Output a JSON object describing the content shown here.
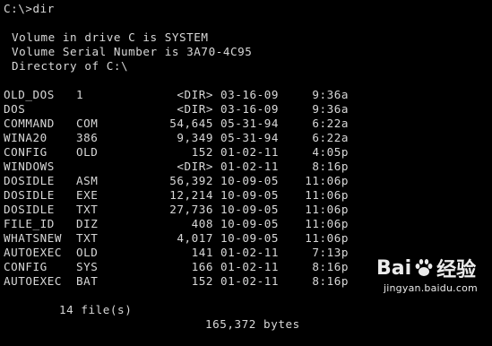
{
  "console": {
    "prompt": "C:\\>dir",
    "volume_label_line": "Volume in drive C is SYSTEM",
    "serial_line": "Volume Serial Number is 3A70-4C95",
    "directory_line": "Directory of C:\\",
    "entries": [
      {
        "name": "OLD_DOS",
        "ext": "1",
        "size": "<DIR>",
        "date": "03-16-09",
        "time": "9:36a"
      },
      {
        "name": "DOS",
        "ext": "",
        "size": "<DIR>",
        "date": "03-16-09",
        "time": "9:36a"
      },
      {
        "name": "COMMAND",
        "ext": "COM",
        "size": "54,645",
        "date": "05-31-94",
        "time": "6:22a"
      },
      {
        "name": "WINA20",
        "ext": "386",
        "size": "9,349",
        "date": "05-31-94",
        "time": "6:22a"
      },
      {
        "name": "CONFIG",
        "ext": "OLD",
        "size": "152",
        "date": "01-02-11",
        "time": "4:05p"
      },
      {
        "name": "WINDOWS",
        "ext": "",
        "size": "<DIR>",
        "date": "01-02-11",
        "time": "8:16p"
      },
      {
        "name": "DOSIDLE",
        "ext": "ASM",
        "size": "56,392",
        "date": "10-09-05",
        "time": "11:06p"
      },
      {
        "name": "DOSIDLE",
        "ext": "EXE",
        "size": "12,214",
        "date": "10-09-05",
        "time": "11:06p"
      },
      {
        "name": "DOSIDLE",
        "ext": "TXT",
        "size": "27,736",
        "date": "10-09-05",
        "time": "11:06p"
      },
      {
        "name": "FILE_ID",
        "ext": "DIZ",
        "size": "408",
        "date": "10-09-05",
        "time": "11:06p"
      },
      {
        "name": "WHATSNEW",
        "ext": "TXT",
        "size": "4,017",
        "date": "10-09-05",
        "time": "11:06p"
      },
      {
        "name": "AUTOEXEC",
        "ext": "OLD",
        "size": "141",
        "date": "01-02-11",
        "time": "7:13p"
      },
      {
        "name": "CONFIG",
        "ext": "SYS",
        "size": "166",
        "date": "01-02-11",
        "time": "8:16p"
      },
      {
        "name": "AUTOEXEC",
        "ext": "BAT",
        "size": "152",
        "date": "01-02-11",
        "time": "8:16p"
      }
    ],
    "summary": {
      "files": "14 file(s)",
      "bytes": "165,372 bytes"
    }
  },
  "watermark": {
    "brand_left": "Bai",
    "brand_right": "经验",
    "url": "jingyan.baidu.com",
    "icon": "paw-icon"
  },
  "colors": {
    "background": "#000000",
    "text": "#d8d8d8"
  }
}
